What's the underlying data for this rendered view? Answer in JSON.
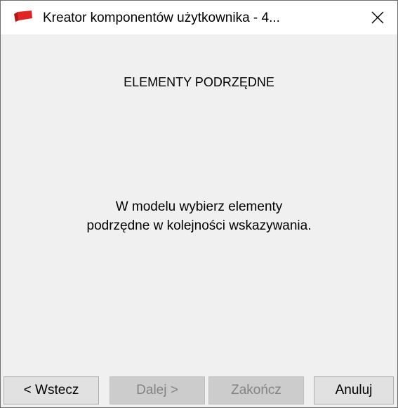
{
  "window": {
    "title": "Kreator komponentów użytkownika - 4...",
    "close_icon": "close-icon",
    "app_icon": "red-brick-app-icon"
  },
  "main": {
    "heading": "ELEMENTY PODRZĘDNE",
    "message_line1": "W modelu wybierz elementy",
    "message_line2": "podrzędne w kolejności wskazywania."
  },
  "buttons": {
    "back": {
      "label": "< Wstecz",
      "enabled": true
    },
    "next": {
      "label": "Dalej >",
      "enabled": false
    },
    "finish": {
      "label": "Zakończ",
      "enabled": false
    },
    "cancel": {
      "label": "Anuluj",
      "enabled": true
    }
  },
  "colors": {
    "titlebar": "#ffffff",
    "body": "#f0f0f0",
    "button": "#e1e1e1",
    "button_disabled": "#cccccc",
    "button_disabled_text": "#838383",
    "app_icon_red": "#e02424",
    "app_icon_blue": "#1f3a8a"
  }
}
